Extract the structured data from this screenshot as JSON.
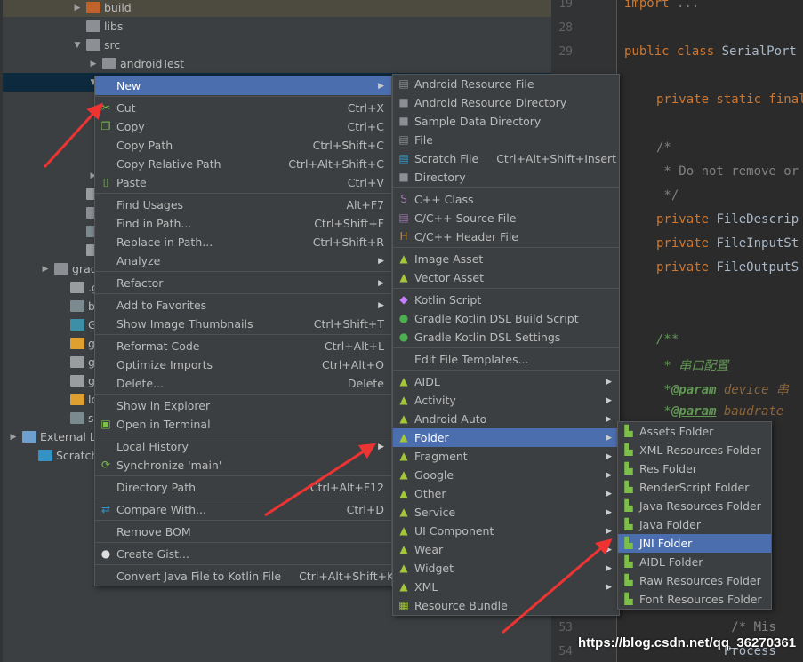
{
  "tree": [
    {
      "label": "build",
      "indent": 4,
      "arrow": "▶",
      "icon": "folder-orange",
      "cls": "top"
    },
    {
      "label": "libs",
      "indent": 4,
      "arrow": "",
      "icon": "folder"
    },
    {
      "label": "src",
      "indent": 4,
      "arrow": "▼",
      "icon": "folder"
    },
    {
      "label": "androidTest",
      "indent": 5,
      "arrow": "▶",
      "icon": "folder"
    },
    {
      "label": "main",
      "indent": 5,
      "arrow": "▼",
      "icon": "folder",
      "cls": "sel"
    },
    {
      "label": "",
      "indent": 6,
      "arrow": "▶",
      "icon": "folder-blue"
    },
    {
      "label": "",
      "indent": 6,
      "arrow": "▶",
      "icon": "folder-blue"
    },
    {
      "label": "",
      "indent": 6,
      "arrow": "▶",
      "icon": "folder"
    },
    {
      "label": "",
      "indent": 6,
      "arrow": "",
      "icon": "manifest"
    },
    {
      "label": "te",
      "indent": 5,
      "arrow": "▶",
      "icon": "folder"
    },
    {
      "label": ".gitig",
      "indent": 4,
      "arrow": "",
      "icon": "file"
    },
    {
      "label": "app.i",
      "indent": 4,
      "arrow": "",
      "icon": "module"
    },
    {
      "label": "build",
      "indent": 4,
      "arrow": "",
      "icon": "gradle"
    },
    {
      "label": "prog",
      "indent": 4,
      "arrow": "",
      "icon": "file"
    },
    {
      "label": "gradle",
      "indent": 2,
      "arrow": "▶",
      "icon": "folder"
    },
    {
      "label": ".gitigno",
      "indent": 3,
      "arrow": "",
      "icon": "file"
    },
    {
      "label": "build.gr",
      "indent": 3,
      "arrow": "",
      "icon": "gradle"
    },
    {
      "label": "Google",
      "indent": 3,
      "arrow": "",
      "icon": "folder-blue"
    },
    {
      "label": "gradle.p",
      "indent": 3,
      "arrow": "",
      "icon": "properties"
    },
    {
      "label": "gradlew",
      "indent": 3,
      "arrow": "",
      "icon": "file"
    },
    {
      "label": "gradlew",
      "indent": 3,
      "arrow": "",
      "icon": "file"
    },
    {
      "label": "local.pro",
      "indent": 3,
      "arrow": "",
      "icon": "properties"
    },
    {
      "label": "settings",
      "indent": 3,
      "arrow": "",
      "icon": "gradle"
    },
    {
      "label": "External Lib",
      "indent": 0,
      "arrow": "▶",
      "icon": "libraries"
    },
    {
      "label": "Scratches a",
      "indent": 1,
      "arrow": "",
      "icon": "scratches"
    }
  ],
  "gutter": [
    {
      "n": "19",
      "row": 0
    },
    {
      "n": "28",
      "row": 1
    },
    {
      "n": "29",
      "row": 2
    },
    {
      "n": "53",
      "row": 26
    },
    {
      "n": "54",
      "row": 27
    }
  ],
  "code": [
    {
      "row": 0,
      "x": 0,
      "parts": [
        [
          "kw",
          "import "
        ],
        [
          "cm",
          "..."
        ]
      ]
    },
    {
      "row": 2,
      "x": 0,
      "parts": [
        [
          "kw",
          "public class "
        ],
        [
          "",
          "SerialPort"
        ]
      ]
    },
    {
      "row": 4,
      "x": 36,
      "parts": [
        [
          "kw",
          "private static final"
        ]
      ]
    },
    {
      "row": 6,
      "x": 36,
      "parts": [
        [
          "cm",
          "/*"
        ]
      ]
    },
    {
      "row": 7,
      "x": 36,
      "parts": [
        [
          "cm",
          " * Do not remove or"
        ]
      ]
    },
    {
      "row": 8,
      "x": 36,
      "parts": [
        [
          "cm",
          " */"
        ]
      ]
    },
    {
      "row": 9,
      "x": 36,
      "parts": [
        [
          "kw",
          "private "
        ],
        [
          "",
          "FileDescrip"
        ]
      ]
    },
    {
      "row": 10,
      "x": 36,
      "parts": [
        [
          "kw",
          "private "
        ],
        [
          "",
          "FileInputSt"
        ]
      ]
    },
    {
      "row": 11,
      "x": 36,
      "parts": [
        [
          "kw",
          "private "
        ],
        [
          "",
          "FileOutputS"
        ]
      ]
    },
    {
      "row": 14,
      "x": 36,
      "parts": [
        [
          "doc",
          "/**"
        ]
      ]
    },
    {
      "row": 15,
      "x": 36,
      "parts": [
        [
          "doc",
          " * 串口配置"
        ]
      ]
    },
    {
      "row": 16,
      "x": 36,
      "parts": [
        [
          "doc",
          " *"
        ],
        [
          "tag",
          "@param"
        ],
        [
          "pv",
          " device 串"
        ]
      ]
    },
    {
      "row": 17,
      "x": 36,
      "parts": [
        [
          "doc",
          " *"
        ],
        [
          "tag",
          "@param"
        ],
        [
          "pv",
          " baudrate"
        ]
      ]
    },
    {
      "row": 18,
      "x": 36,
      "parts": [
        [
          "doc",
          "          y 奇"
        ]
      ]
    },
    {
      "row": 19,
      "x": 36,
      "parts": [
        [
          "doc",
          "          its"
        ]
      ]
    },
    {
      "row": 20,
      "x": 36,
      "parts": [
        [
          "doc",
          "          its"
        ]
      ]
    },
    {
      "row": 22,
      "x": 36,
      "parts": [
        [
          "",
          "          ort(P"
        ]
      ]
    },
    {
      "row": 23,
      "x": 36,
      "parts": [
        [
          "",
          "          ccess"
        ]
      ]
    },
    {
      "row": 24,
      "x": 36,
      "parts": [
        [
          "",
          "         e.can"
        ]
      ]
    },
    {
      "row": 25,
      "x": 36,
      "parts": [
        [
          "",
          "          try {"
        ]
      ]
    },
    {
      "row": 26,
      "x": 36,
      "parts": [
        [
          "cm",
          "          /* Mis"
        ]
      ]
    },
    {
      "row": 27,
      "x": 36,
      "parts": [
        [
          "",
          "         Process"
        ]
      ]
    }
  ],
  "context_menu": [
    {
      "label": "New",
      "sub": true,
      "hl": true
    },
    "-",
    {
      "label": "Cut",
      "sc": "Ctrl+X",
      "icon": "scissors-icon",
      "g": "✂"
    },
    {
      "label": "Copy",
      "sc": "Ctrl+C",
      "icon": "copy-icon",
      "g": "❐"
    },
    {
      "label": "Copy Path",
      "sc": "Ctrl+Shift+C"
    },
    {
      "label": "Copy Relative Path",
      "sc": "Ctrl+Alt+Shift+C"
    },
    {
      "label": "Paste",
      "sc": "Ctrl+V",
      "icon": "clipboard-icon",
      "g": "▯"
    },
    "-",
    {
      "label": "Find Usages",
      "sc": "Alt+F7"
    },
    {
      "label": "Find in Path...",
      "sc": "Ctrl+Shift+F"
    },
    {
      "label": "Replace in Path...",
      "sc": "Ctrl+Shift+R"
    },
    {
      "label": "Analyze",
      "sub": true
    },
    "-",
    {
      "label": "Refactor",
      "sub": true
    },
    "-",
    {
      "label": "Add to Favorites",
      "sub": true
    },
    {
      "label": "Show Image Thumbnails",
      "sc": "Ctrl+Shift+T"
    },
    "-",
    {
      "label": "Reformat Code",
      "sc": "Ctrl+Alt+L"
    },
    {
      "label": "Optimize Imports",
      "sc": "Ctrl+Alt+O"
    },
    {
      "label": "Delete...",
      "sc": "Delete"
    },
    "-",
    {
      "label": "Show in Explorer"
    },
    {
      "label": "Open in Terminal",
      "icon": "terminal-icon",
      "g": "▣"
    },
    "-",
    {
      "label": "Local History",
      "sub": true
    },
    {
      "label": "Synchronize 'main'",
      "icon": "sync-icon",
      "g": "⟳"
    },
    "-",
    {
      "label": "Directory Path",
      "sc": "Ctrl+Alt+F12"
    },
    "-",
    {
      "label": "Compare With...",
      "sc": "Ctrl+D",
      "icon": "compare-icon",
      "g": "⇄",
      "c": "#3592c4"
    },
    "-",
    {
      "label": "Remove BOM"
    },
    "-",
    {
      "label": "Create Gist...",
      "icon": "github-icon",
      "g": "●",
      "c": "#ddd"
    },
    "-",
    {
      "label": "Convert Java File to Kotlin File",
      "sc": "Ctrl+Alt+Shift+K"
    }
  ],
  "new_menu": [
    {
      "label": "Android Resource File",
      "icon": "android-file-icon",
      "g": "▤",
      "c": "#8c9094"
    },
    {
      "label": "Android Resource Directory",
      "icon": "folder-icon",
      "g": "■",
      "c": "#8c9094"
    },
    {
      "label": "Sample Data Directory",
      "icon": "folder-icon",
      "g": "■",
      "c": "#8c9094"
    },
    {
      "label": "File",
      "icon": "file-icon",
      "g": "▤",
      "c": "#8c9094"
    },
    {
      "label": "Scratch File",
      "sc": "Ctrl+Alt+Shift+Insert",
      "icon": "scratch-file-icon",
      "g": "▤",
      "c": "#3592c4"
    },
    {
      "label": "Directory",
      "icon": "folder-icon",
      "g": "■",
      "c": "#8c9094"
    },
    "-",
    {
      "label": "C++ Class",
      "icon": "cpp-class-icon",
      "g": "S",
      "c": "#9876aa"
    },
    {
      "label": "C/C++ Source File",
      "icon": "cpp-source-icon",
      "g": "▤",
      "c": "#9876aa"
    },
    {
      "label": "C/C++ Header File",
      "icon": "cpp-header-icon",
      "g": "H",
      "c": "#c08b30"
    },
    "-",
    {
      "label": "Image Asset",
      "icon": "android-icon",
      "g": "▲",
      "c": "#a4c639"
    },
    {
      "label": "Vector Asset",
      "icon": "android-icon",
      "g": "▲",
      "c": "#a4c639"
    },
    "-",
    {
      "label": "Kotlin Script",
      "icon": "kotlin-icon",
      "g": "◆",
      "c": "#c77dff"
    },
    {
      "label": "Gradle Kotlin DSL Build Script",
      "icon": "gradle-kotlin-icon",
      "g": "●",
      "c": "#4caf50"
    },
    {
      "label": "Gradle Kotlin DSL Settings",
      "icon": "gradle-kotlin-icon",
      "g": "●",
      "c": "#4caf50"
    },
    "-",
    {
      "label": "Edit File Templates..."
    },
    "-",
    {
      "label": "AIDL",
      "sub": true,
      "icon": "android-icon",
      "g": "▲",
      "c": "#a4c639"
    },
    {
      "label": "Activity",
      "sub": true,
      "icon": "android-icon",
      "g": "▲",
      "c": "#a4c639"
    },
    {
      "label": "Android Auto",
      "sub": true,
      "icon": "android-icon",
      "g": "▲",
      "c": "#a4c639"
    },
    {
      "label": "Folder",
      "sub": true,
      "hl": true,
      "icon": "android-icon",
      "g": "▲",
      "c": "#a4c639"
    },
    {
      "label": "Fragment",
      "sub": true,
      "icon": "android-icon",
      "g": "▲",
      "c": "#a4c639"
    },
    {
      "label": "Google",
      "sub": true,
      "icon": "android-icon",
      "g": "▲",
      "c": "#a4c639"
    },
    {
      "label": "Other",
      "sub": true,
      "icon": "android-icon",
      "g": "▲",
      "c": "#a4c639"
    },
    {
      "label": "Service",
      "sub": true,
      "icon": "android-icon",
      "g": "▲",
      "c": "#a4c639"
    },
    {
      "label": "UI Component",
      "sub": true,
      "icon": "android-icon",
      "g": "▲",
      "c": "#a4c639"
    },
    {
      "label": "Wear",
      "sub": true,
      "icon": "android-icon",
      "g": "▲",
      "c": "#a4c639"
    },
    {
      "label": "Widget",
      "sub": true,
      "icon": "android-icon",
      "g": "▲",
      "c": "#a4c639"
    },
    {
      "label": "XML",
      "sub": true,
      "icon": "android-icon",
      "g": "▲",
      "c": "#a4c639"
    },
    {
      "label": "Resource Bundle",
      "icon": "resource-bundle-icon",
      "g": "▦",
      "c": "#a4c639"
    }
  ],
  "folder_menu": [
    {
      "label": "Assets Folder"
    },
    {
      "label": "XML Resources Folder"
    },
    {
      "label": "Res Folder"
    },
    {
      "label": "RenderScript Folder"
    },
    {
      "label": "Java Resources Folder"
    },
    {
      "label": "Java Folder"
    },
    {
      "label": "JNI Folder",
      "hl": true
    },
    {
      "label": "AIDL Folder"
    },
    {
      "label": "Raw Resources Folder"
    },
    {
      "label": "Font Resources Folder"
    }
  ],
  "watermark": "https://blog.csdn.net/qq_36270361",
  "colors": {
    "accent": "#4b6eaf",
    "annotation_arrow": "#ee3333",
    "selection": "#0d293e"
  }
}
